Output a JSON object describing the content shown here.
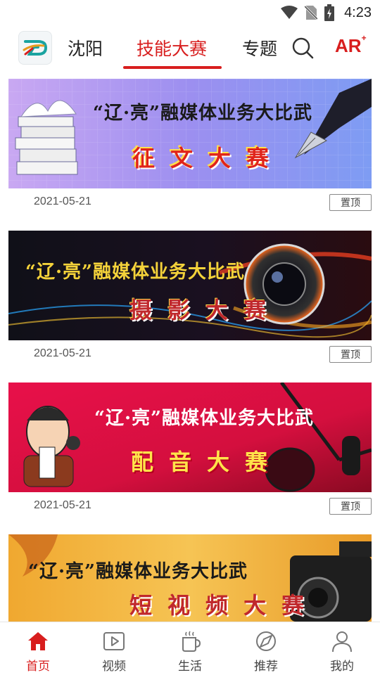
{
  "status_bar": {
    "time": "4:23",
    "icons": [
      "wifi-icon",
      "no-sim-icon",
      "battery-charging-icon"
    ]
  },
  "header": {
    "logo_icon": "app-logo",
    "tabs": [
      {
        "label": "沈阳",
        "active": false
      },
      {
        "label": "技能大赛",
        "active": true
      },
      {
        "label": "专题",
        "active": false
      }
    ],
    "search_icon": "search-icon",
    "ar_label": "AR",
    "ar_sup": "+",
    "accent_color": "#d81e1e"
  },
  "feed": [
    {
      "banner_title": "“辽·亮”融媒体业务大比武",
      "banner_subtitle": "征文大赛",
      "theme": "essay",
      "date": "2021-05-21",
      "pin_label": "置顶"
    },
    {
      "banner_title": "“辽·亮”融媒体业务大比武",
      "banner_subtitle": "摄影大赛",
      "theme": "photo",
      "date": "2021-05-21",
      "pin_label": "置顶"
    },
    {
      "banner_title": "“辽·亮”融媒体业务大比武",
      "banner_subtitle": "配音大赛",
      "theme": "dubbing",
      "date": "2021-05-21",
      "pin_label": "置顶"
    },
    {
      "banner_title": "“辽·亮”融媒体业务大比武",
      "banner_subtitle": "短视频大赛",
      "theme": "video"
    }
  ],
  "bottom_tabs": [
    {
      "label": "首页",
      "icon": "home-icon",
      "active": true
    },
    {
      "label": "视频",
      "icon": "video-icon",
      "active": false
    },
    {
      "label": "生活",
      "icon": "cup-icon",
      "active": false
    },
    {
      "label": "推荐",
      "icon": "compass-icon",
      "active": false
    },
    {
      "label": "我的",
      "icon": "user-icon",
      "active": false
    }
  ]
}
